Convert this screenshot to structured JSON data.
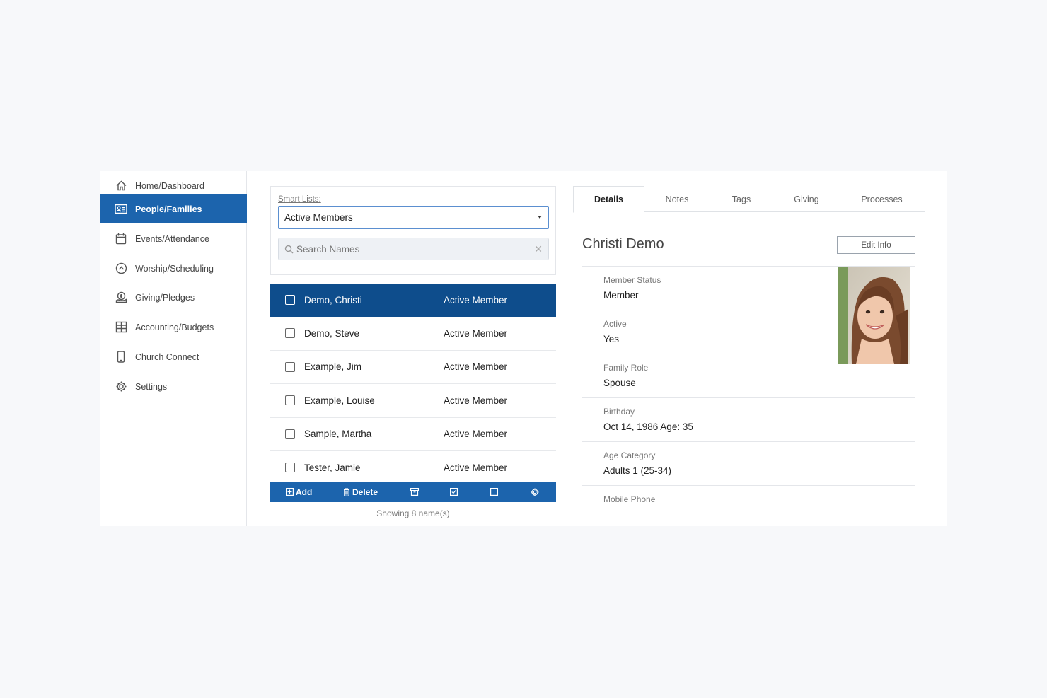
{
  "sidebar": {
    "items": [
      {
        "label": "Home/Dashboard",
        "icon": "home-icon"
      },
      {
        "label": "People/Families",
        "icon": "id-card-icon",
        "active": true
      },
      {
        "label": "Events/Attendance",
        "icon": "calendar-icon"
      },
      {
        "label": "Worship/Scheduling",
        "icon": "chevron-up-circle-icon"
      },
      {
        "label": "Giving/Pledges",
        "icon": "donation-icon"
      },
      {
        "label": "Accounting/Budgets",
        "icon": "grid-icon"
      },
      {
        "label": "Church Connect",
        "icon": "phone-icon"
      },
      {
        "label": "Settings",
        "icon": "gear-icon"
      }
    ]
  },
  "smart_lists": {
    "label": "Smart Lists:",
    "selected": "Active Members",
    "search_placeholder": "Search Names",
    "clear_symbol": "✕"
  },
  "people": [
    {
      "name": "Demo, Christi",
      "status": "Active Member",
      "selected": true
    },
    {
      "name": "Demo, Steve",
      "status": "Active Member"
    },
    {
      "name": "Example, Jim",
      "status": "Active Member"
    },
    {
      "name": "Example, Louise",
      "status": "Active Member"
    },
    {
      "name": "Sample, Martha",
      "status": "Active Member"
    },
    {
      "name": "Tester, Jamie",
      "status": "Active Member"
    }
  ],
  "toolbar": {
    "add_label": "Add",
    "delete_label": "Delete"
  },
  "showing_text": "Showing 8 name(s)",
  "tabs": [
    "Details",
    "Notes",
    "Tags",
    "Giving",
    "Processes"
  ],
  "details": {
    "name": "Christi Demo",
    "edit_label": "Edit Info",
    "fields": [
      {
        "label": "Member Status",
        "value": "Member"
      },
      {
        "label": "Active",
        "value": "Yes"
      },
      {
        "label": "Family Role",
        "value": "Spouse"
      },
      {
        "label": "Birthday",
        "value": "Oct 14, 1986 Age: 35"
      },
      {
        "label": "Age Category",
        "value": "Adults 1 (25-34)"
      },
      {
        "label": "Mobile Phone",
        "value": ""
      }
    ]
  },
  "colors": {
    "accent": "#1c64ad",
    "selected_row": "#0e4d8c",
    "background": "#f7f8fa"
  }
}
